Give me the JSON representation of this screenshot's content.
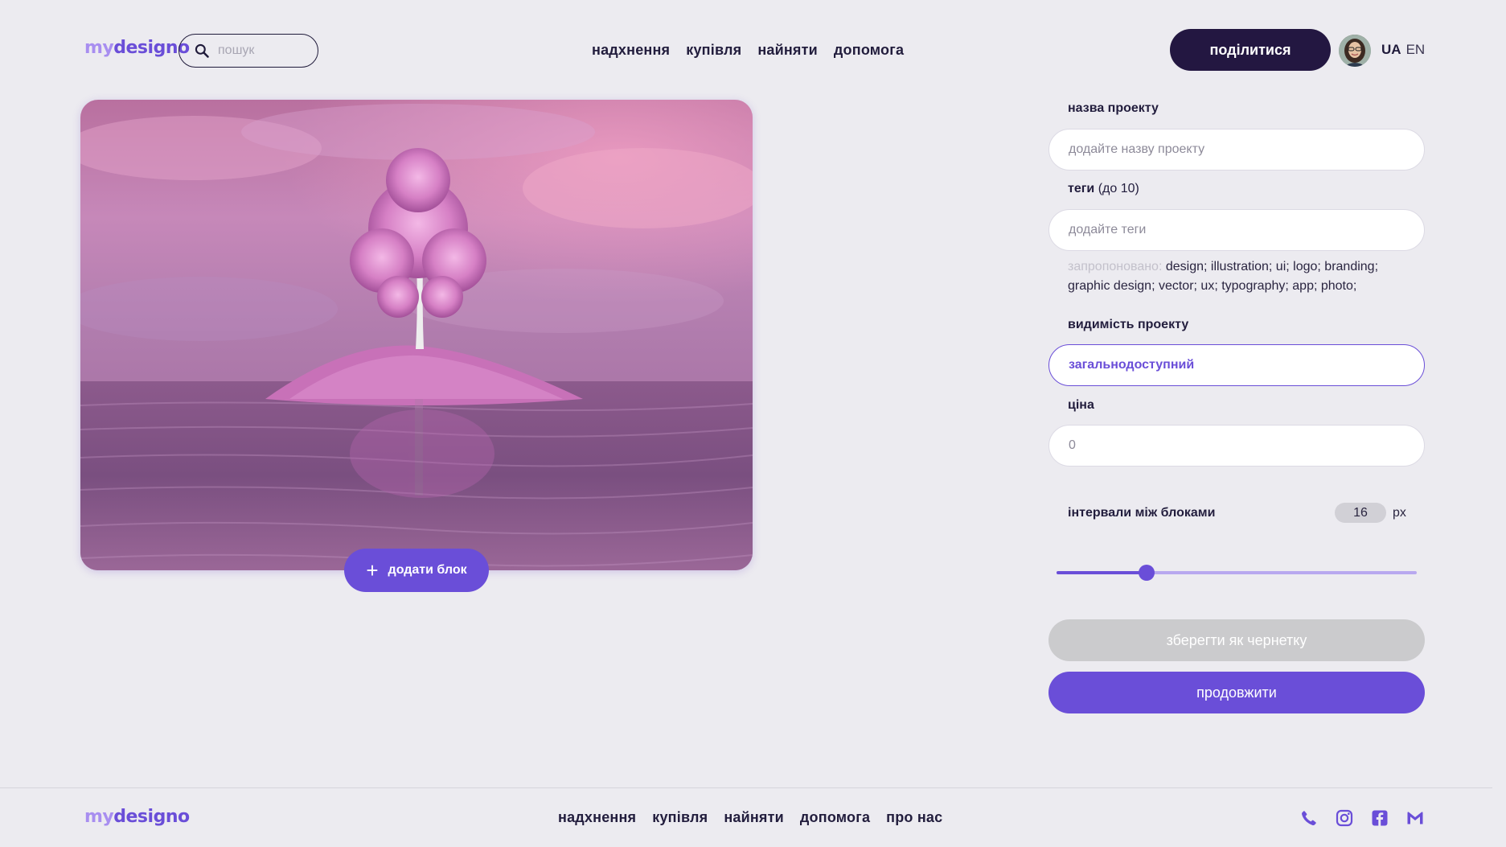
{
  "header": {
    "logo_my": "my",
    "logo_designo": "designo",
    "search_placeholder": "пошук",
    "nav": [
      "надхнення",
      "купівля",
      "найняти",
      "допомога"
    ],
    "share_label": "поділитися",
    "lang_active": "UA",
    "lang_other": "EN"
  },
  "editor": {
    "add_block_label": "додати блок"
  },
  "form": {
    "name_label": "назва проекту",
    "name_placeholder": "додайте назву проекту",
    "tags_label": "теги",
    "tags_note": "(до 10)",
    "tags_placeholder": "додайте теги",
    "suggested_label": "запропоновано:",
    "suggested_tags": "design; illustration; ui; logo; branding; graphic design; vector; ux; typography; app; photo;",
    "visibility_label": "видимість проекту",
    "visibility_value": "загальнодоступний",
    "price_label": "ціна",
    "price_value": "0",
    "gap_label": "інтервали між блоками",
    "gap_value": "16",
    "gap_unit": "px",
    "gap_slider_fraction": 0.25,
    "draft_label": "зберегти як чернетку",
    "continue_label": "продовжити"
  },
  "footer": {
    "logo_my": "my",
    "logo_designo": "designo",
    "nav": [
      "надхнення",
      "купівля",
      "найняти",
      "допомога",
      "про нас"
    ],
    "socials": [
      "phone-icon",
      "instagram-icon",
      "facebook-icon",
      "gmail-icon"
    ]
  },
  "colors": {
    "accent": "#6a4ed8",
    "dark": "#231741",
    "background": "#ecebf0",
    "disabled": "#cbcbcd"
  }
}
